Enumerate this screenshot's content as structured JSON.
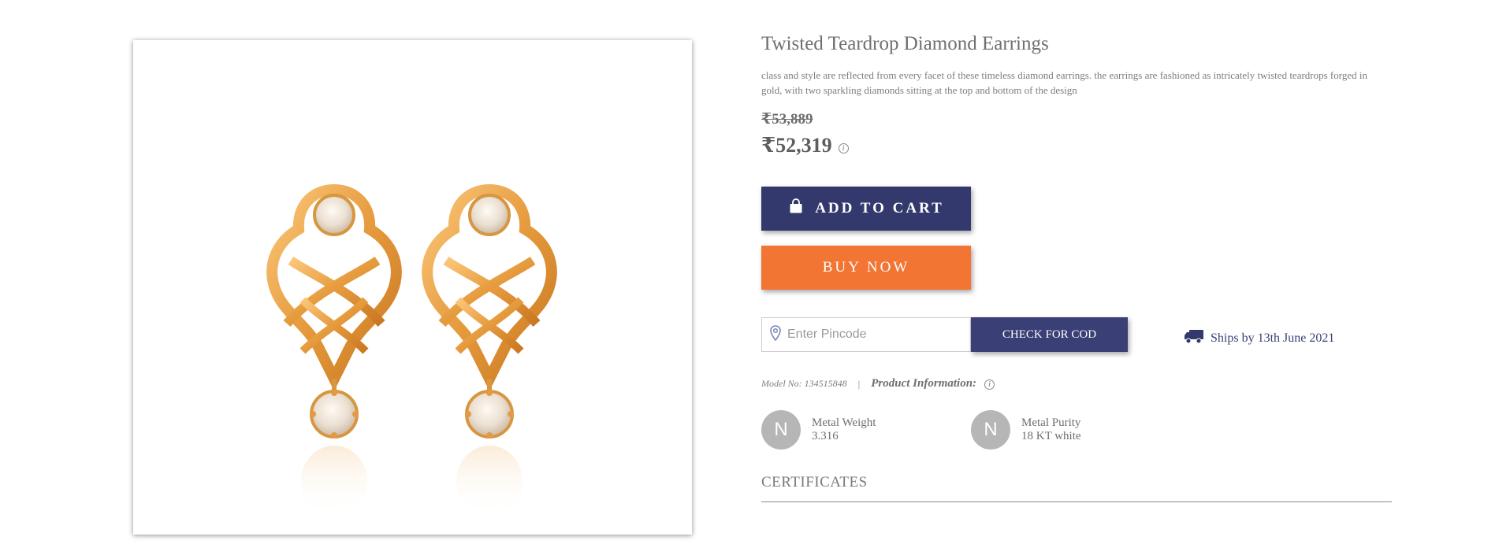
{
  "product": {
    "title": "Twisted Teardrop Diamond Earrings",
    "description": "class and style are reflected from every facet of these timeless diamond earrings. the earrings are fashioned as intricately twisted teardrops forged in gold, with two sparkling diamonds sitting at the top and bottom of the design",
    "old_price": "₹53,889",
    "price": "₹52,319",
    "info_icon": "i"
  },
  "actions": {
    "add_to_cart": "ADD TO CART",
    "buy_now": "BUY NOW"
  },
  "pincode": {
    "placeholder": "Enter Pincode",
    "value": "",
    "check_label": "CHECK FOR COD"
  },
  "shipping": {
    "text": "Ships by 13th June 2021"
  },
  "meta": {
    "model": "Model No: 134515848",
    "separator": "|",
    "product_info_label": "Product Information:"
  },
  "specs": [
    {
      "initial": "N",
      "label": "Metal Weight",
      "value": "3.316"
    },
    {
      "initial": "N",
      "label": "Metal Purity",
      "value": "18 KT white"
    }
  ],
  "certificates": {
    "label": "CERTIFICATES"
  },
  "colors": {
    "navy": "#33386d",
    "orange": "#f27534",
    "gold": "#e8a04a",
    "avatar_gray": "#b6b6b6"
  },
  "icons": {
    "cart": "shopping-bag-icon",
    "pin": "location-pin-icon",
    "truck": "truck-icon",
    "info": "info-icon"
  }
}
